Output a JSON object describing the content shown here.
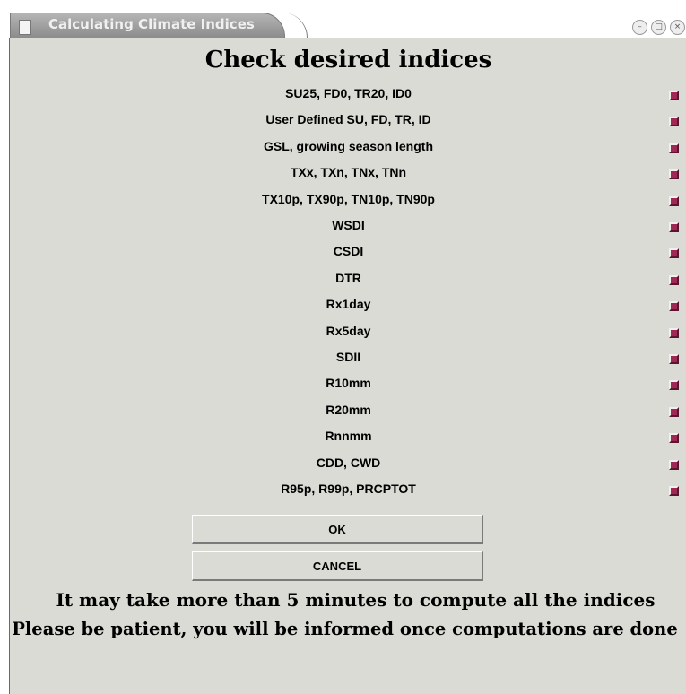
{
  "window": {
    "title": "Calculating Climate Indices",
    "icons": {
      "document": "document-icon",
      "minimize": "minimize-icon",
      "maximize": "maximize-icon",
      "close": "close-icon"
    }
  },
  "heading": "Check desired indices",
  "indices": [
    {
      "label": "SU25, FD0, TR20, ID0",
      "checked": true
    },
    {
      "label": "User Defined SU, FD, TR, ID",
      "checked": true
    },
    {
      "label": "GSL, growing season length",
      "checked": true
    },
    {
      "label": "TXx, TXn, TNx, TNn",
      "checked": true
    },
    {
      "label": "TX10p, TX90p, TN10p, TN90p",
      "checked": true
    },
    {
      "label": "WSDI",
      "checked": true
    },
    {
      "label": "CSDI",
      "checked": true
    },
    {
      "label": "DTR",
      "checked": true
    },
    {
      "label": "Rx1day",
      "checked": true
    },
    {
      "label": "Rx5day",
      "checked": true
    },
    {
      "label": "SDII",
      "checked": true
    },
    {
      "label": "R10mm",
      "checked": true
    },
    {
      "label": "R20mm",
      "checked": true
    },
    {
      "label": "Rnnmm",
      "checked": true
    },
    {
      "label": "CDD, CWD",
      "checked": true
    },
    {
      "label": "R95p, R99p, PRCPTOT",
      "checked": true
    }
  ],
  "buttons": {
    "ok": "OK",
    "cancel": "CANCEL"
  },
  "messages": {
    "line1": "It may take more than 5 minutes to compute all the indices",
    "line2": "Please be patient, you will be informed once computations are done"
  },
  "colors": {
    "checkbox": "#a02855",
    "background": "#dbdbd5"
  }
}
